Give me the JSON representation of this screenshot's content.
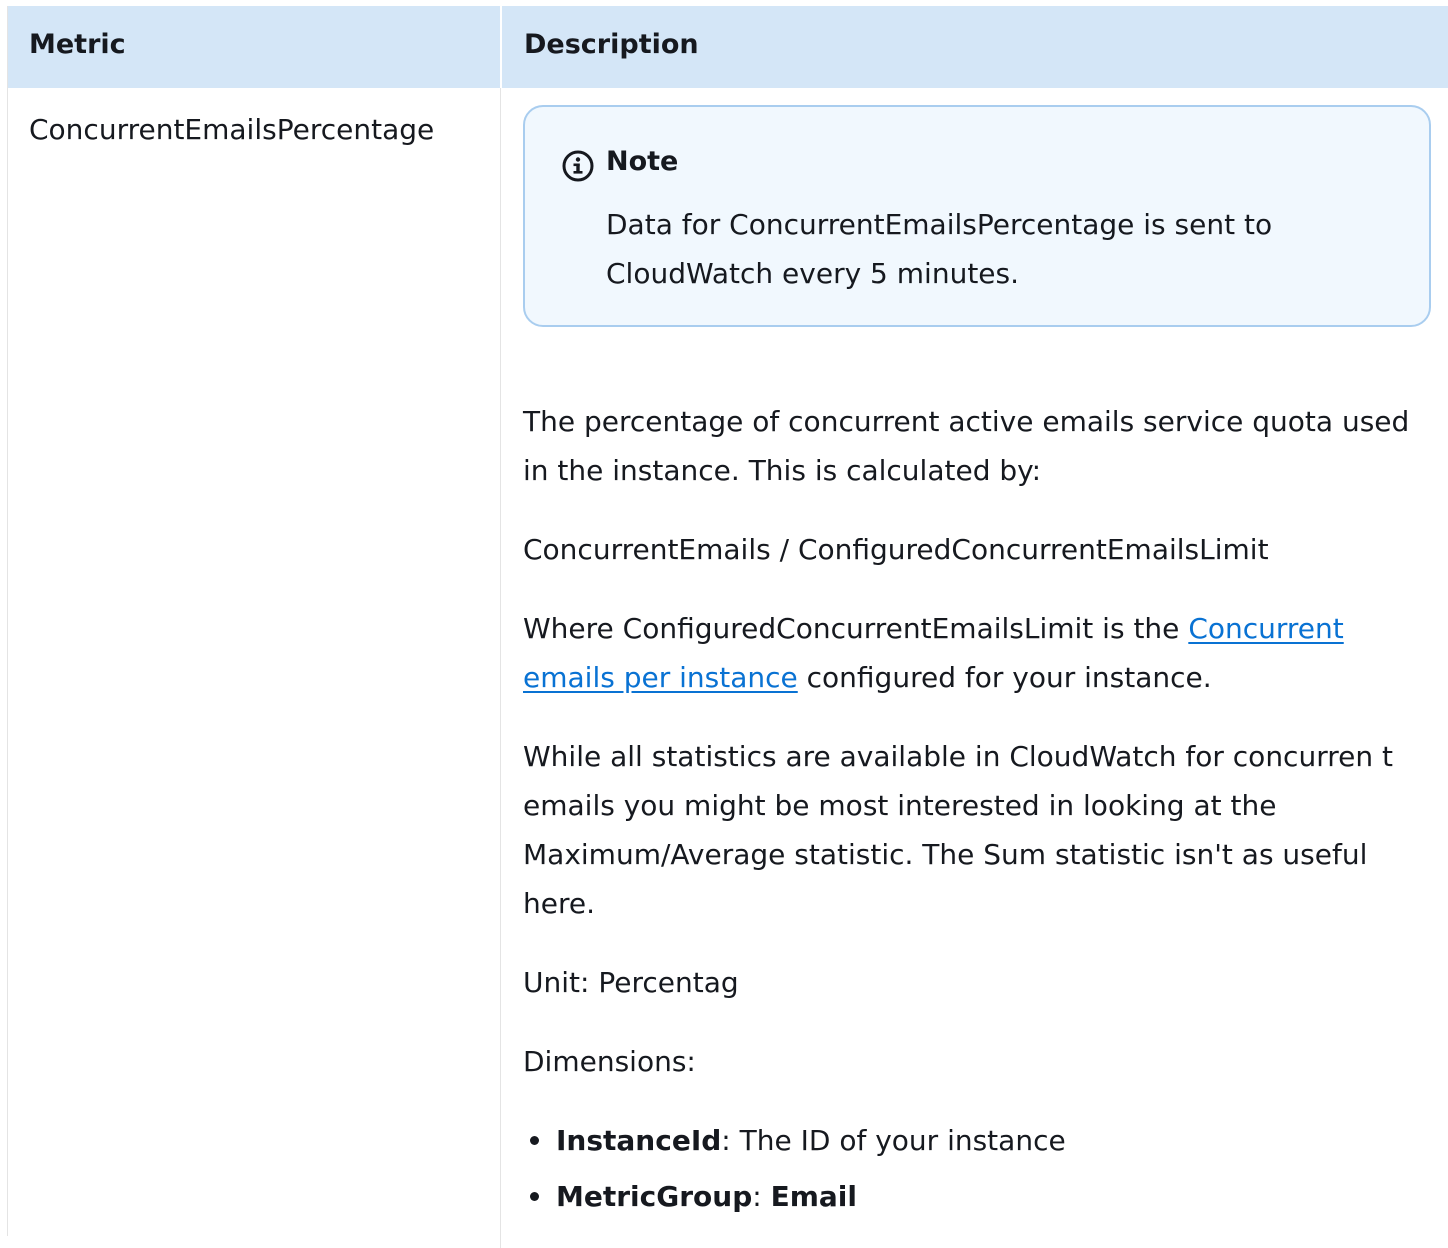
{
  "table": {
    "headers": {
      "metric": "Metric",
      "description": "Description"
    },
    "row": {
      "metric_name": "ConcurrentEmailsPercentage",
      "note": {
        "icon": "info-icon",
        "title": "Note",
        "text": "Data for ConcurrentEmailsPercentage is sent to CloudWatch every 5 minutes."
      },
      "paragraphs": {
        "p1": "The percentage of concurrent active emails service quota used in the instance. This is calculated by:",
        "p2": "ConcurrentEmails / ConfiguredConcurrentEmailsLimit",
        "p3_before": "Where ConfiguredConcurrentEmailsLimit is the ",
        "p3_link": "Concurrent emails per instance",
        "p3_after": " configured for your instance.",
        "p4": "While all statistics are available in CloudWatch for concurren t emails you might be most interested in looking at the Maximum/Average statistic. The Sum statistic isn't as useful here.",
        "p5": "Unit: Percentag",
        "p6": "Dimensions:"
      },
      "dimensions": [
        {
          "name": "InstanceId",
          "separator": ": ",
          "value": "The ID of your instance"
        },
        {
          "name": "MetricGroup",
          "separator": ": ",
          "value": "Email"
        }
      ]
    }
  },
  "colors": {
    "header_bg": "#d4e6f7",
    "note_border": "#a9cdef",
    "note_bg": "#f1f8fe",
    "link": "#0972d3",
    "text": "#16191f"
  }
}
